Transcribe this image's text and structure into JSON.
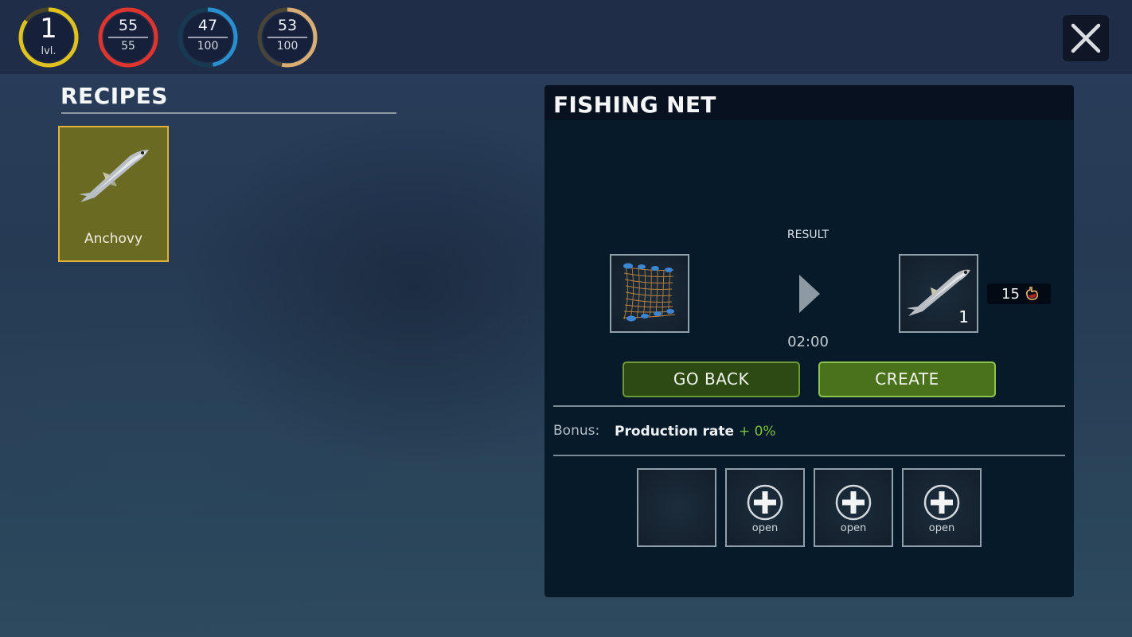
{
  "stats": {
    "level": {
      "value": "1",
      "label": "lvl.",
      "progress": 0.85,
      "color": "#e0c21e"
    },
    "health": {
      "current": "55",
      "max": "55",
      "progress": 1.0,
      "color": "#e0342f"
    },
    "water": {
      "current": "47",
      "max": "100",
      "progress": 0.47,
      "color": "#2a8fd0"
    },
    "food": {
      "current": "53",
      "max": "100",
      "progress": 0.53,
      "color": "#d9ad73"
    }
  },
  "close_button": {
    "icon": "close-icon"
  },
  "recipes": {
    "title": "RECIPES",
    "items": [
      {
        "label": "Anchovy",
        "icon": "anchovy-fish-icon",
        "selected": true
      }
    ]
  },
  "panel": {
    "title": "FISHING NET",
    "result_label": "RESULT",
    "ingredient": {
      "icon": "fishing-net-icon"
    },
    "timer": "02:00",
    "result": {
      "icon": "anchovy-fish-icon",
      "quantity": "1"
    },
    "hunger_value": "15",
    "buttons": {
      "go_back": "GO BACK",
      "create": "CREATE"
    },
    "bonus": {
      "label": "Bonus:",
      "name": "Production rate",
      "value": "+ 0%"
    },
    "slots": [
      {
        "state": "empty",
        "label": ""
      },
      {
        "state": "locked",
        "label": "open"
      },
      {
        "state": "locked",
        "label": "open"
      },
      {
        "state": "locked",
        "label": "open"
      }
    ]
  },
  "colors": {
    "accent_green": "#7cc23a",
    "card_selected_border": "#e1b13a",
    "create_button": "#4a711c",
    "go_back_button": "#2d4a13"
  }
}
